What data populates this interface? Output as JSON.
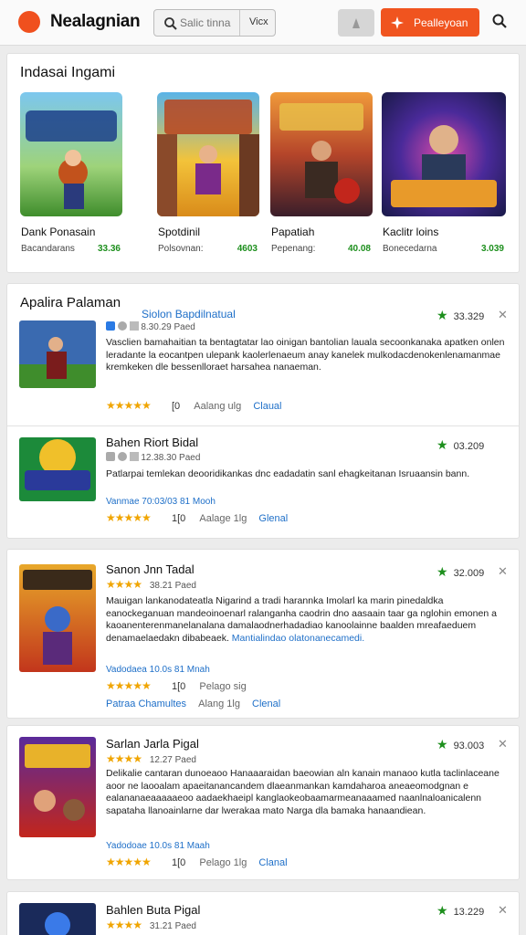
{
  "header": {
    "brand": "Nealagnian",
    "search_placeholder": "Salic tinna",
    "view_label": "Vicx",
    "cta_label": "Pealleyoan",
    "accent": "#f0541f"
  },
  "featured": {
    "title": "Indasai Ingami",
    "items": [
      {
        "name": "Dank Ponasain",
        "sub": "Bacandarans",
        "price": "33.36",
        "art": "ADRODAS"
      },
      {
        "name": "Spotdinil",
        "sub": "Polsovnan:",
        "price": "4603",
        "art": "KANDAN"
      },
      {
        "name": "Papatiah",
        "sub": "Pepenang:",
        "price": "40.08",
        "art": "BREDAK"
      },
      {
        "name": "Kaclitr loins",
        "sub": "Bonecedarna",
        "price": "3.039",
        "art": "SREGADIAN"
      }
    ]
  },
  "list": {
    "title": "Apalira Palaman",
    "rows": [
      {
        "title": "Siolon Bapdilnatual",
        "meta": "8.30.29 Paed",
        "desc": "Vasclien bamahaitian ta bentagtatar lao oinigan bantolian lauala secoonkanaka apatken onlen leradante la eocantpen ulepank kaolerlenaeum anay kanelek mulkodacdenokenlenamanmae kremkeken dle bessenlloraet harsahea nanaeman.",
        "stars": "★★★★★",
        "count": "[0",
        "aside": "Aalang ulg",
        "link": "Claual",
        "score": "33.329"
      },
      {
        "title": "Bahen Riort Bidal",
        "meta": "12.38.30 Paed",
        "desc": "Patlarpai temlekan deooridikankas dnc eadadatin sanl ehagkeitanan Isruaansin bann.",
        "extra": "Vanmae 70:03/03 81 Mooh",
        "stars": "★★★★★",
        "count": "1[0",
        "aside": "Aalage 1lg",
        "link": "Glenal",
        "score": "03.209"
      },
      {
        "title": "Sanon Jnn Tadal",
        "meta": "38.21 Paed",
        "desc": "Mauigan lankanodateatla Nigarind a tradi harannka Imolarl ka marin pinedaldka eanockeganuan mandeoinoenarl ralanganha caodrin dno aasaain taar ga nglohin emonen a kaoanenterenmanelanalana damalaodnerhadadiao kanoolainne baalden mreafaeduem denamaelaedakn dibabeaek.",
        "desc_link": "Mantialindao olatonanecamedi.",
        "extra": "Vadodaea 10.0s 81 Mnah",
        "stars_top": "★★★★",
        "stars": "★★★★★",
        "count": "1[0",
        "aside": "Pelago sig",
        "tag": "Patraa Chamultes",
        "aside2": "Alang 1lg",
        "link": "Clenal",
        "score": "32.009"
      },
      {
        "title": "Sarlan Jarla Pigal",
        "meta": "12.27 Paed",
        "desc": "Delikalie cantaran dunoeaoo Hanaaaraidan baeowian aln kanain manaoo kutla taclinlaceane aoor ne laooalam apaeitanancandem dlaeanmankan kamdaharoa aneaeomodgnan e ealananaeaaaaaeoo aadaekhaeipl kanglaokeobaamarmeanaaamed naanlnaloanicalenn sapataha llanoainlarne dar lwerakaa mato Narga dla bamaka hanaandiean.",
        "extra": "Yadodoae 10.0s 81 Maah",
        "stars_top": "★★★★",
        "stars": "★★★★★",
        "count": "1[0",
        "aside": "Pelago 1lg",
        "link": "Clanal",
        "score": "93.003"
      },
      {
        "title": "Bahlen Buta Pigal",
        "meta": "31.21 Paed",
        "stars_top": "★★★★",
        "score": "13.229"
      }
    ]
  },
  "colors": {
    "green": "#1d8f1d",
    "link": "#1e6fc8",
    "star": "#f0a500"
  }
}
